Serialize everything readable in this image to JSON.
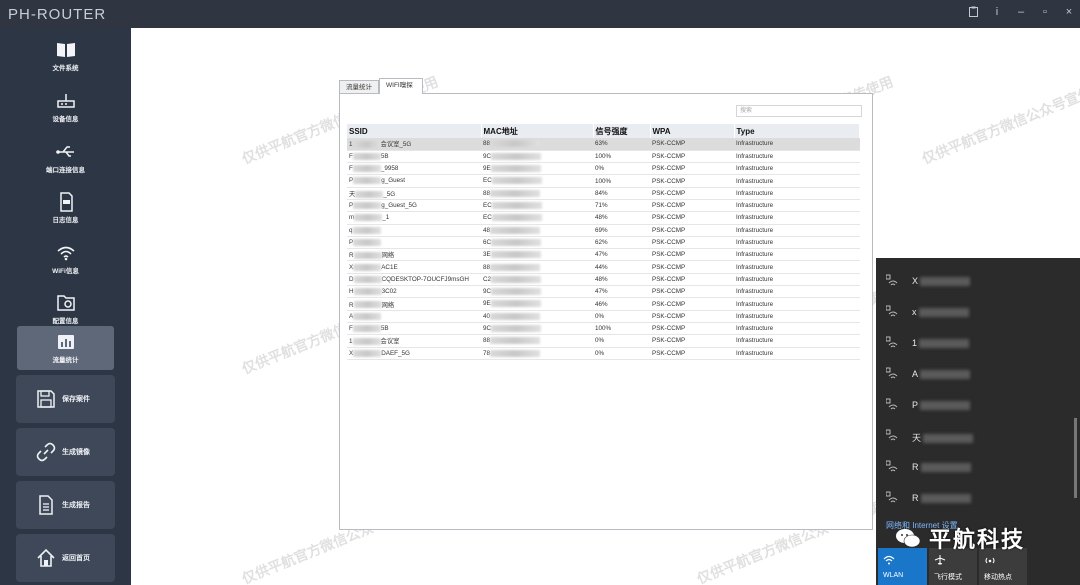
{
  "app": {
    "title": "PH-ROUTER"
  },
  "titlebar_icons": [
    "clipboard-icon",
    "info-icon",
    "minimize-icon",
    "restore-icon",
    "close-icon"
  ],
  "titlebar_glyphs": {
    "info": "i",
    "minimize": "–",
    "restore": "▫",
    "close": "×"
  },
  "sidebar": {
    "items": [
      {
        "label": "文件系统",
        "icon": "book-icon"
      },
      {
        "label": "设备信息",
        "icon": "router-icon"
      },
      {
        "label": "端口连接信息",
        "icon": "usb-icon"
      },
      {
        "label": "日志信息",
        "icon": "log-file-icon"
      },
      {
        "label": "WiFi信息",
        "icon": "wifi-icon"
      },
      {
        "label": "配置信息",
        "icon": "config-folder-icon"
      },
      {
        "label": "流量统计",
        "icon": "bar-chart-icon",
        "active": true
      }
    ],
    "actions": [
      {
        "label": "保存案件",
        "icon": "save-icon"
      },
      {
        "label": "生成镜像",
        "icon": "link-icon"
      },
      {
        "label": "生成报告",
        "icon": "report-icon"
      },
      {
        "label": "返回首页",
        "icon": "home-icon"
      }
    ]
  },
  "tabs": [
    {
      "label": "流量统计"
    },
    {
      "label": "WIFI嗅探",
      "active": true
    }
  ],
  "search": {
    "placeholder": "搜索"
  },
  "table": {
    "headers": [
      "SSID",
      "MAC地址",
      "信号强度",
      "WPA",
      "Type"
    ],
    "rows": [
      {
        "ssid_a": "1",
        "ssid_b": "会议室_5G",
        "mac": "88",
        "signal": "63%",
        "wpa": "PSK-CCMP",
        "type": "Infrastructure",
        "selected": true
      },
      {
        "ssid_a": "F",
        "ssid_b": "5B",
        "mac": "9C",
        "signal": "100%",
        "wpa": "PSK-CCMP",
        "type": "Infrastructure"
      },
      {
        "ssid_a": "F",
        "ssid_b": "_9958",
        "mac": "9E",
        "signal": "0%",
        "wpa": "PSK-CCMP",
        "type": "Infrastructure"
      },
      {
        "ssid_a": "P",
        "ssid_b": "g_Guest",
        "mac": "EC",
        "signal": "100%",
        "wpa": "PSK-CCMP",
        "type": "Infrastructure"
      },
      {
        "ssid_a": "天",
        "ssid_b": "_5G",
        "mac": "88",
        "signal": "84%",
        "wpa": "PSK-CCMP",
        "type": "Infrastructure"
      },
      {
        "ssid_a": "P",
        "ssid_b": "g_Guest_5G",
        "mac": "EC",
        "signal": "71%",
        "wpa": "PSK-CCMP",
        "type": "Infrastructure"
      },
      {
        "ssid_a": "m",
        "ssid_b": "_1",
        "mac": "EC",
        "signal": "48%",
        "wpa": "PSK-CCMP",
        "type": "Infrastructure"
      },
      {
        "ssid_a": "q",
        "ssid_b": "",
        "mac": "48",
        "signal": "69%",
        "wpa": "PSK-CCMP",
        "type": "Infrastructure"
      },
      {
        "ssid_a": "P",
        "ssid_b": "",
        "mac": "6C",
        "signal": "62%",
        "wpa": "PSK-CCMP",
        "type": "Infrastructure"
      },
      {
        "ssid_a": "R",
        "ssid_b": "网络",
        "mac": "3E",
        "signal": "47%",
        "wpa": "PSK-CCMP",
        "type": "Infrastructure"
      },
      {
        "ssid_a": "X",
        "ssid_b": "AC1E",
        "mac": "88",
        "signal": "44%",
        "wpa": "PSK-CCMP",
        "type": "Infrastructure"
      },
      {
        "ssid_a": "D",
        "ssid_b": "CQDESKTOP-7OUCFJ9msGH",
        "mac": "C2",
        "signal": "48%",
        "wpa": "PSK-CCMP",
        "type": "Infrastructure"
      },
      {
        "ssid_a": "H",
        "ssid_b": "3C02",
        "mac": "9C",
        "signal": "47%",
        "wpa": "PSK-CCMP",
        "type": "Infrastructure"
      },
      {
        "ssid_a": "R",
        "ssid_b": "网络",
        "mac": "9E",
        "signal": "46%",
        "wpa": "PSK-CCMP",
        "type": "Infrastructure"
      },
      {
        "ssid_a": "A",
        "ssid_b": "",
        "mac": "40",
        "signal": "0%",
        "wpa": "PSK-CCMP",
        "type": "Infrastructure"
      },
      {
        "ssid_a": "F",
        "ssid_b": "5B",
        "mac": "9C",
        "signal": "100%",
        "wpa": "PSK-CCMP",
        "type": "Infrastructure"
      },
      {
        "ssid_a": "1",
        "ssid_b": "会议室",
        "mac": "88",
        "signal": "0%",
        "wpa": "PSK-CCMP",
        "type": "Infrastructure"
      },
      {
        "ssid_a": "X",
        "ssid_b": "DAEF_5G",
        "mac": "78",
        "signal": "0%",
        "wpa": "PSK-CCMP",
        "type": "Infrastructure"
      }
    ]
  },
  "wifi_flyout": {
    "networks": [
      {
        "name": "X"
      },
      {
        "name": "x"
      },
      {
        "name": "1"
      },
      {
        "name": "A"
      },
      {
        "name": "P"
      },
      {
        "name": "天"
      },
      {
        "name": "R"
      },
      {
        "name": "R"
      }
    ],
    "settings_link": "网络和 Internet 设置",
    "quick_actions": [
      {
        "label": "WLAN",
        "active": true
      },
      {
        "label": "飞行模式"
      },
      {
        "label": "移动热点"
      }
    ]
  },
  "watermark": "仅供平航官方微信公众号宣传使用",
  "brand": {
    "name": "平航科技"
  },
  "colors": {
    "sidebar": "#2d3644",
    "titlebar": "#2f3541",
    "accent": "#1976c8",
    "flyout": "#2b2b2b"
  }
}
